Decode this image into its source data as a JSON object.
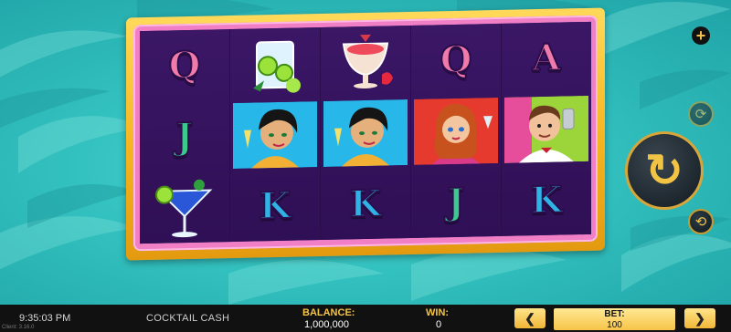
{
  "game": {
    "title": "COCKTAIL CASH",
    "version": "Client: 3.16.0"
  },
  "status": {
    "time": "9:35:03 PM"
  },
  "reels": [
    [
      {
        "symbol": "Q",
        "kind": "letter"
      },
      {
        "symbol": "J",
        "kind": "letter"
      },
      {
        "symbol": "martini-glass",
        "kind": "picture"
      }
    ],
    [
      {
        "symbol": "lime-tumbler",
        "kind": "picture"
      },
      {
        "symbol": "woman-dark-hair",
        "kind": "picture"
      },
      {
        "symbol": "K",
        "kind": "letter"
      }
    ],
    [
      {
        "symbol": "strawberry-cocktail",
        "kind": "picture"
      },
      {
        "symbol": "woman-dark-hair",
        "kind": "picture"
      },
      {
        "symbol": "K",
        "kind": "letter"
      }
    ],
    [
      {
        "symbol": "Q",
        "kind": "letter"
      },
      {
        "symbol": "woman-red-hair",
        "kind": "picture"
      },
      {
        "symbol": "J",
        "kind": "letter"
      }
    ],
    [
      {
        "symbol": "A",
        "kind": "letter"
      },
      {
        "symbol": "bartender-man",
        "kind": "picture"
      },
      {
        "symbol": "K",
        "kind": "letter"
      }
    ]
  ],
  "controls": {
    "plus_icon": "+",
    "autoplay_icon": "⟳",
    "spin_icon": "↻",
    "turbo_icon": "⟲"
  },
  "footer": {
    "balance_label": "BALANCE:",
    "balance_value": "1,000,000",
    "win_label": "WIN:",
    "win_value": "0",
    "bet_label": "BET:",
    "bet_value": "100",
    "bet_down": "❮",
    "bet_up": "❯"
  },
  "colors": {
    "frame_gold": "#f5b41f",
    "frame_pink": "#f07fc6",
    "reel_bg": "#3a1563",
    "background_teal": "#35c4c2",
    "accent_gold": "#f3c34a"
  }
}
